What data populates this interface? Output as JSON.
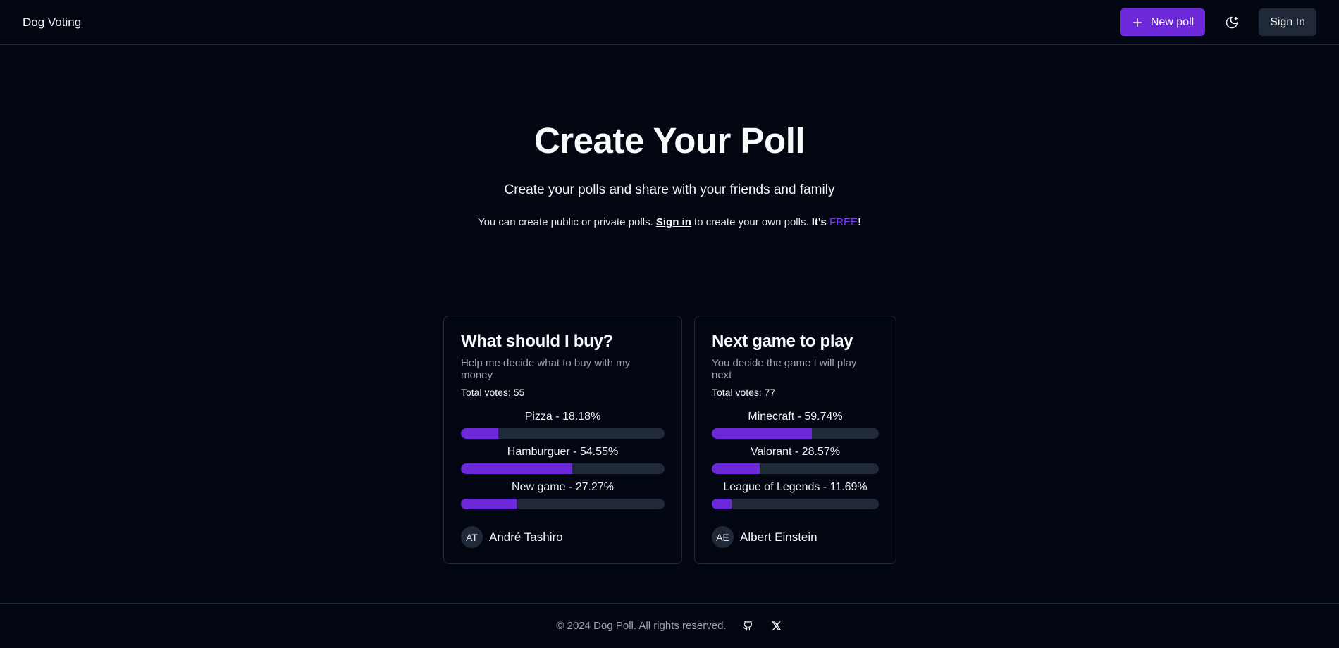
{
  "header": {
    "brand": "Dog Voting",
    "new_poll_label": "New poll",
    "sign_in_label": "Sign In"
  },
  "hero": {
    "title": "Create Your Poll",
    "subtitle": "Create your polls and share with your friends and family",
    "note_prefix": "You can create public or private polls. ",
    "note_link": "Sign in",
    "note_middle": " to create your own polls. ",
    "note_its": "It's ",
    "note_free": "FREE",
    "note_end": "!"
  },
  "polls": [
    {
      "title": "What should I buy?",
      "description": "Help me decide what to buy with my money",
      "total_votes": "Total votes: 55",
      "options": [
        {
          "label": "Pizza - 18.18%",
          "percent": 18.18
        },
        {
          "label": "Hamburguer - 54.55%",
          "percent": 54.55
        },
        {
          "label": "New game - 27.27%",
          "percent": 27.27
        }
      ],
      "author": {
        "initials": "AT",
        "name": "André Tashiro"
      }
    },
    {
      "title": "Next game to play",
      "description": "You decide the game I will play next",
      "total_votes": "Total votes: 77",
      "options": [
        {
          "label": "Minecraft - 59.74%",
          "percent": 59.74
        },
        {
          "label": "Valorant - 28.57%",
          "percent": 28.57
        },
        {
          "label": "League of Legends - 11.69%",
          "percent": 11.69
        }
      ],
      "author": {
        "initials": "AE",
        "name": "Albert Einstein"
      }
    }
  ],
  "footer": {
    "copyright": "© 2024 Dog Poll. All rights reserved.",
    "icons": [
      "github-icon",
      "x-icon"
    ]
  },
  "colors": {
    "accent": "#6d28d9",
    "background": "#030712",
    "border": "#1f2937"
  }
}
